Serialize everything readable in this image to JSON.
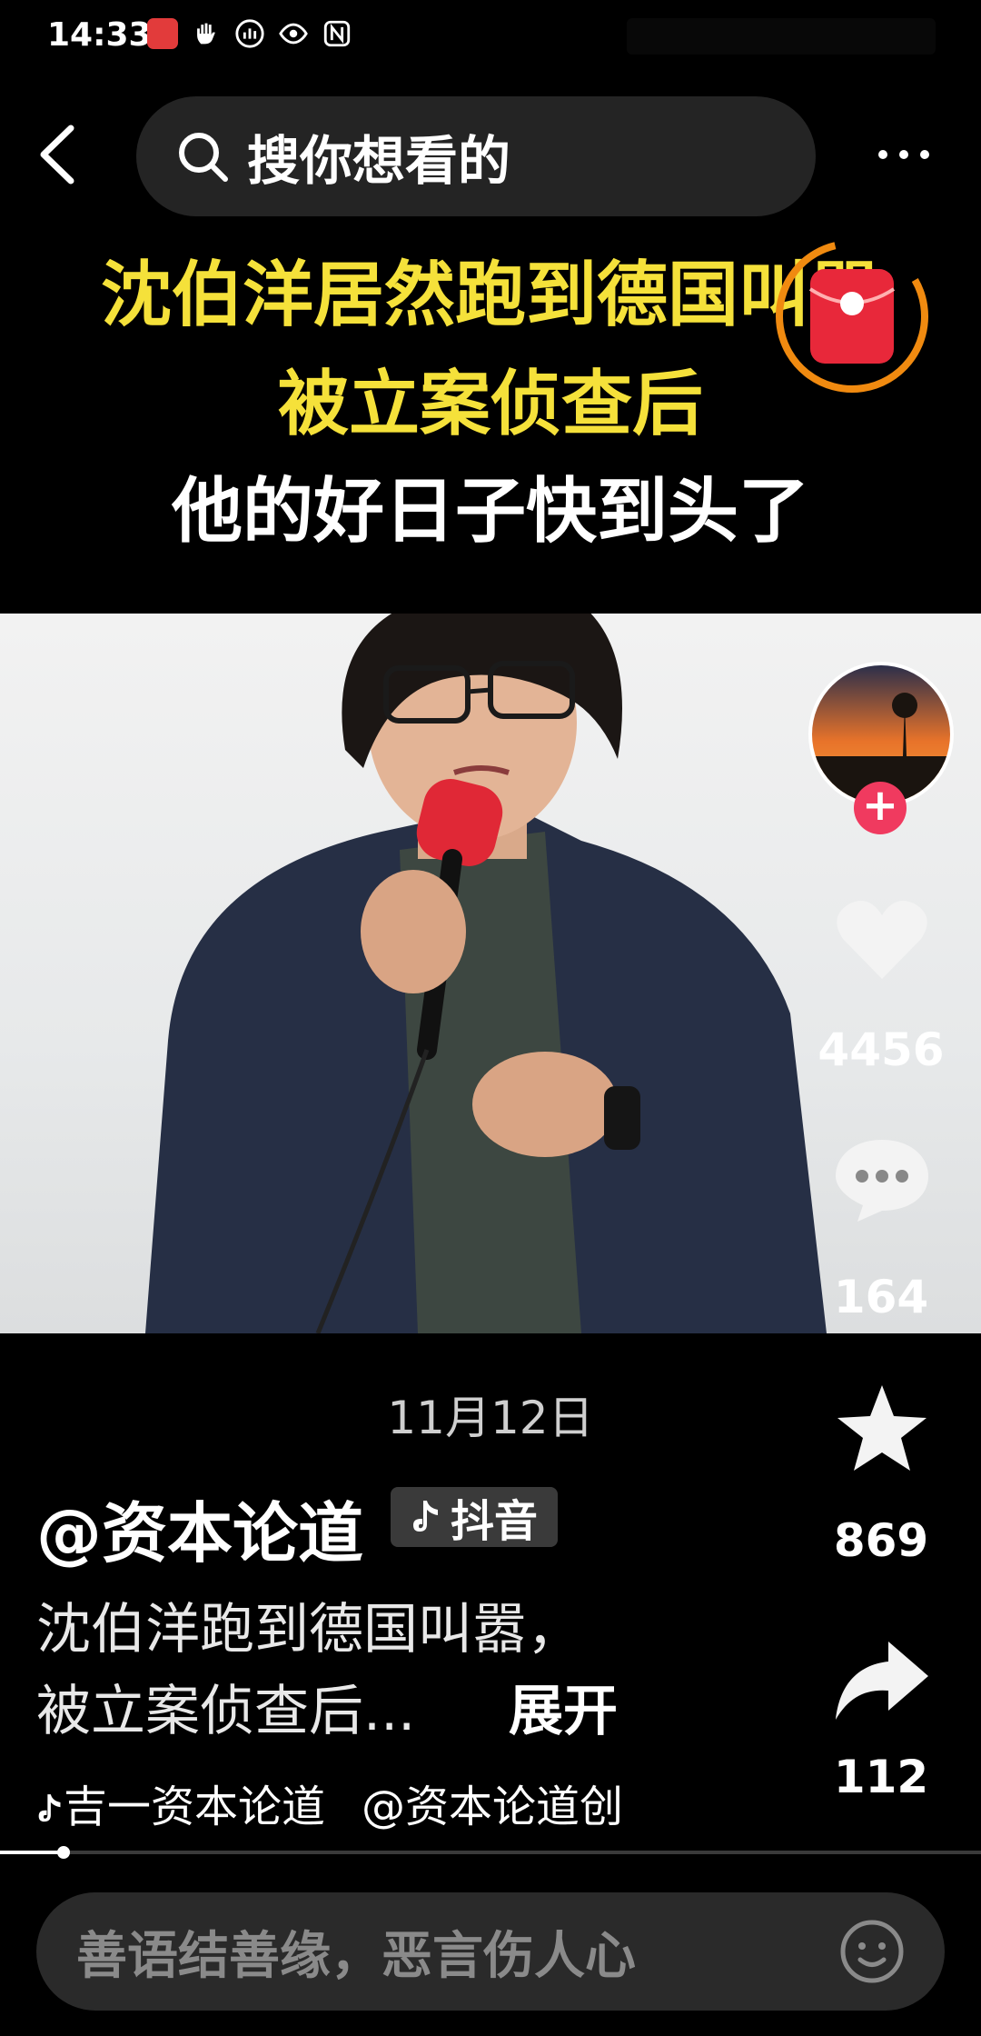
{
  "status": {
    "time": "14:33",
    "icons": [
      "app-icon",
      "hand-icon",
      "signal-icon",
      "eye-icon",
      "nfc-icon"
    ]
  },
  "header": {
    "search_placeholder": "搜你想看的"
  },
  "video": {
    "headline_1": "沈伯洋居然跑到德国叫嚣",
    "headline_2": "被立案侦查后",
    "headline_3": "他的好日子快到头了"
  },
  "rail": {
    "likes": "4456",
    "comments": "164",
    "favorites": "869",
    "shares": "112"
  },
  "info": {
    "date": "11月12日",
    "author": "@资本论道",
    "platform_badge": "抖音",
    "description_line1": "沈伯洋跑到德国叫嚣，",
    "description_line2": "被立案侦查后...",
    "expand_label": "展开",
    "tags": [
      "吉一资本论道",
      "@资本论道创"
    ]
  },
  "progress": 0.065,
  "comment": {
    "placeholder": "善语结善缘，恶言伤人心"
  },
  "colors": {
    "headline_yellow": "#f5e13a",
    "follow_pink": "#f03a5f",
    "background": "#000000"
  }
}
